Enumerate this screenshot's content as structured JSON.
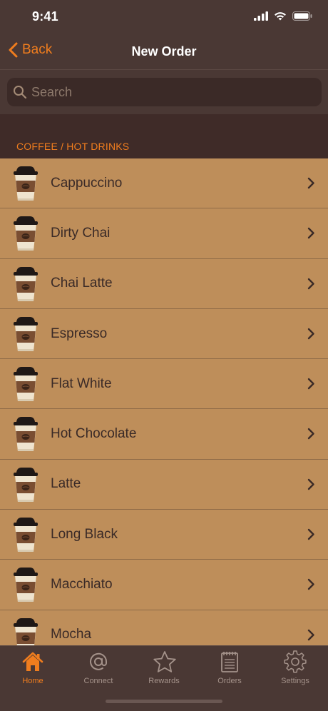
{
  "status_bar": {
    "time": "9:41"
  },
  "nav": {
    "back_label": "Back",
    "title": "New Order"
  },
  "search": {
    "placeholder": "Search",
    "value": ""
  },
  "section": {
    "header": "COFFEE / HOT DRINKS"
  },
  "items": [
    {
      "label": "Cappuccino",
      "icon": "coffee-cup-icon"
    },
    {
      "label": "Dirty Chai",
      "icon": "coffee-cup-icon"
    },
    {
      "label": "Chai Latte",
      "icon": "coffee-cup-icon"
    },
    {
      "label": "Espresso",
      "icon": "coffee-cup-icon"
    },
    {
      "label": "Flat White",
      "icon": "coffee-cup-icon"
    },
    {
      "label": "Hot Chocolate",
      "icon": "coffee-cup-icon"
    },
    {
      "label": "Latte",
      "icon": "coffee-cup-icon"
    },
    {
      "label": "Long Black",
      "icon": "coffee-cup-icon"
    },
    {
      "label": "Macchiato",
      "icon": "coffee-cup-icon"
    },
    {
      "label": "Mocha",
      "icon": "coffee-cup-icon"
    }
  ],
  "tabs": [
    {
      "label": "Home",
      "icon": "home-icon",
      "active": true
    },
    {
      "label": "Connect",
      "icon": "at-sign-icon",
      "active": false
    },
    {
      "label": "Rewards",
      "icon": "star-icon",
      "active": false
    },
    {
      "label": "Orders",
      "icon": "notepad-icon",
      "active": false
    },
    {
      "label": "Settings",
      "icon": "gear-icon",
      "active": false
    }
  ],
  "colors": {
    "accent": "#f07d1e",
    "bar_background": "#4a3834",
    "list_background": "#be8e5a",
    "section_background": "#3f2b28"
  }
}
